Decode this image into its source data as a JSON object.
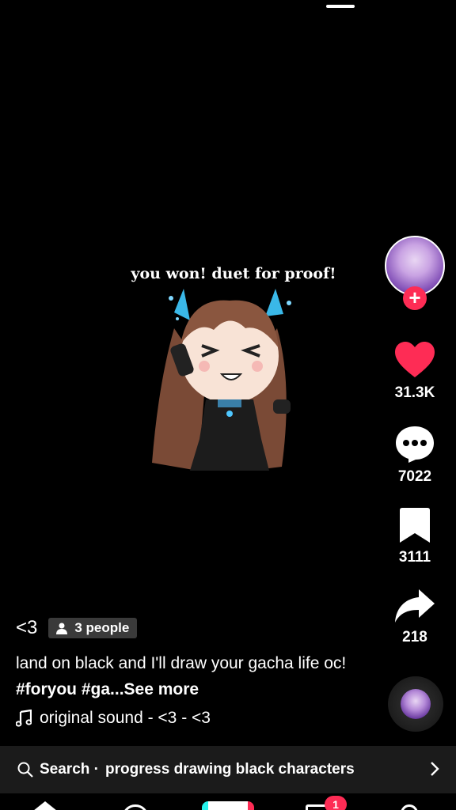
{
  "video": {
    "overlay_text": "you won! duet for proof!"
  },
  "rail": {
    "likes": "31.3K",
    "comments": "7022",
    "saves": "3111",
    "shares": "218"
  },
  "post": {
    "author": "<3",
    "people_tag": "3 people",
    "description_text": "land on black and I'll draw your gacha life oc! ",
    "description_tags": "#foryou #ga...",
    "see_more": "See more",
    "sound": "original sound - <3 - <3"
  },
  "search": {
    "label": "Search ·",
    "query": "progress drawing black characters"
  },
  "tabs": {
    "inbox_badge": "1"
  },
  "colors": {
    "like": "#fe2c55",
    "accent_cyan": "#25f4ee",
    "search_bg": "#1b1b1b"
  },
  "icons": [
    "heart-icon",
    "comment-icon",
    "bookmark-icon",
    "share-icon",
    "music-note-icon",
    "search-icon",
    "chevron-right-icon",
    "person-icon",
    "plus-icon"
  ]
}
